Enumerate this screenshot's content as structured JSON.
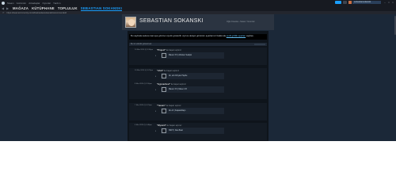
{
  "menubar": {
    "items": [
      "Steam",
      "Görünüm",
      "Arkadaşlar",
      "Oyunlar",
      "Yardım"
    ],
    "user_box": "sebastiansokanski"
  },
  "nav": {
    "tabs": [
      "MAĞAZA",
      "KÜTÜPHANE",
      "TOPLULUK",
      "SEBASTIAN SOKANSKI"
    ],
    "active_index": 3
  },
  "url": "https://steamcommunity.com/id/sebastiansokanski/recommended/",
  "profile": {
    "name": "SEBASTIAN SOKANSKI",
    "subtitle": "Oğlu Kosoka › Steam Yorumlar"
  },
  "notice": {
    "text": "Bu sayfada sadece kamuya görünen içerik gösterilir. Ayrıca detaylı görünüm ayarlarınız hakkında",
    "link": "profil gizlilik ayarları",
    "tail": "sayfası."
  },
  "filter": {
    "label": "Bu tür etkinlik göstermek"
  },
  "activities": [
    {
      "date": "10 Mar 2024 @ 5:30pm",
      "game": "\"Project\"",
      "action": "ile başarı açtınız",
      "achievement": "Maven XX | Abroken Sealpsi"
    },
    {
      "date": "10 Mar 2024 @ 5:22pm",
      "game": "\"Ahrii\"",
      "action": "ile başarı açtınız",
      "achievement": "Ah, at's Khrylen Haphe"
    },
    {
      "date": "8 Mar 2024 @ 9:16pm",
      "game": "\"Hypnachest\"",
      "action": "ile başarı açtınız",
      "achievement": "Maven XX | Maven XX"
    },
    {
      "date": "7 Mar 2024 @ 6:21pm",
      "game": "\"Yanum\"",
      "action": "ile başarı açtınız",
      "achievement": "Ab e'll | Kapadeblays"
    },
    {
      "date": "6 Mar 2024 @ 4:48pm",
      "game": "\"Wyvard\"",
      "action": "ile başarı açtınız",
      "achievement": "NSFT | New Beat"
    }
  ]
}
